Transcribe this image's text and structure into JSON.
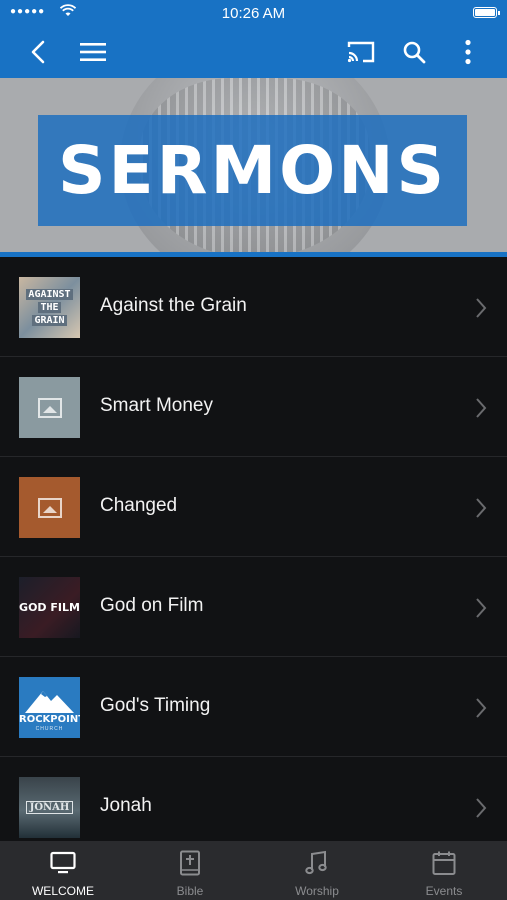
{
  "status_bar": {
    "time": "10:26 AM",
    "signal": "●●●●●"
  },
  "nav": {
    "colors": {
      "bar": "#1872c4"
    }
  },
  "hero": {
    "title": "SERMONS"
  },
  "sermons": [
    {
      "title": "Against the Grain",
      "thumb_text": [
        "AGAINST",
        "THE",
        "GRAIN"
      ]
    },
    {
      "title": "Smart Money",
      "thumb_color": "#8a9aa0"
    },
    {
      "title": "Changed",
      "thumb_color": "#a55a2e"
    },
    {
      "title": "God on Film",
      "thumb_text": "GOD FILM"
    },
    {
      "title": "God's Timing",
      "thumb_text": "ROCKPOINT",
      "thumb_sub": "CHURCH"
    },
    {
      "title": "Jonah",
      "thumb_text": "JONAH"
    }
  ],
  "tabs": [
    {
      "label": "WELCOME",
      "icon": "monitor-icon",
      "active": true
    },
    {
      "label": "Bible",
      "icon": "bible-icon",
      "active": false
    },
    {
      "label": "Worship",
      "icon": "music-note-icon",
      "active": false
    },
    {
      "label": "Events",
      "icon": "calendar-icon",
      "active": false
    }
  ]
}
